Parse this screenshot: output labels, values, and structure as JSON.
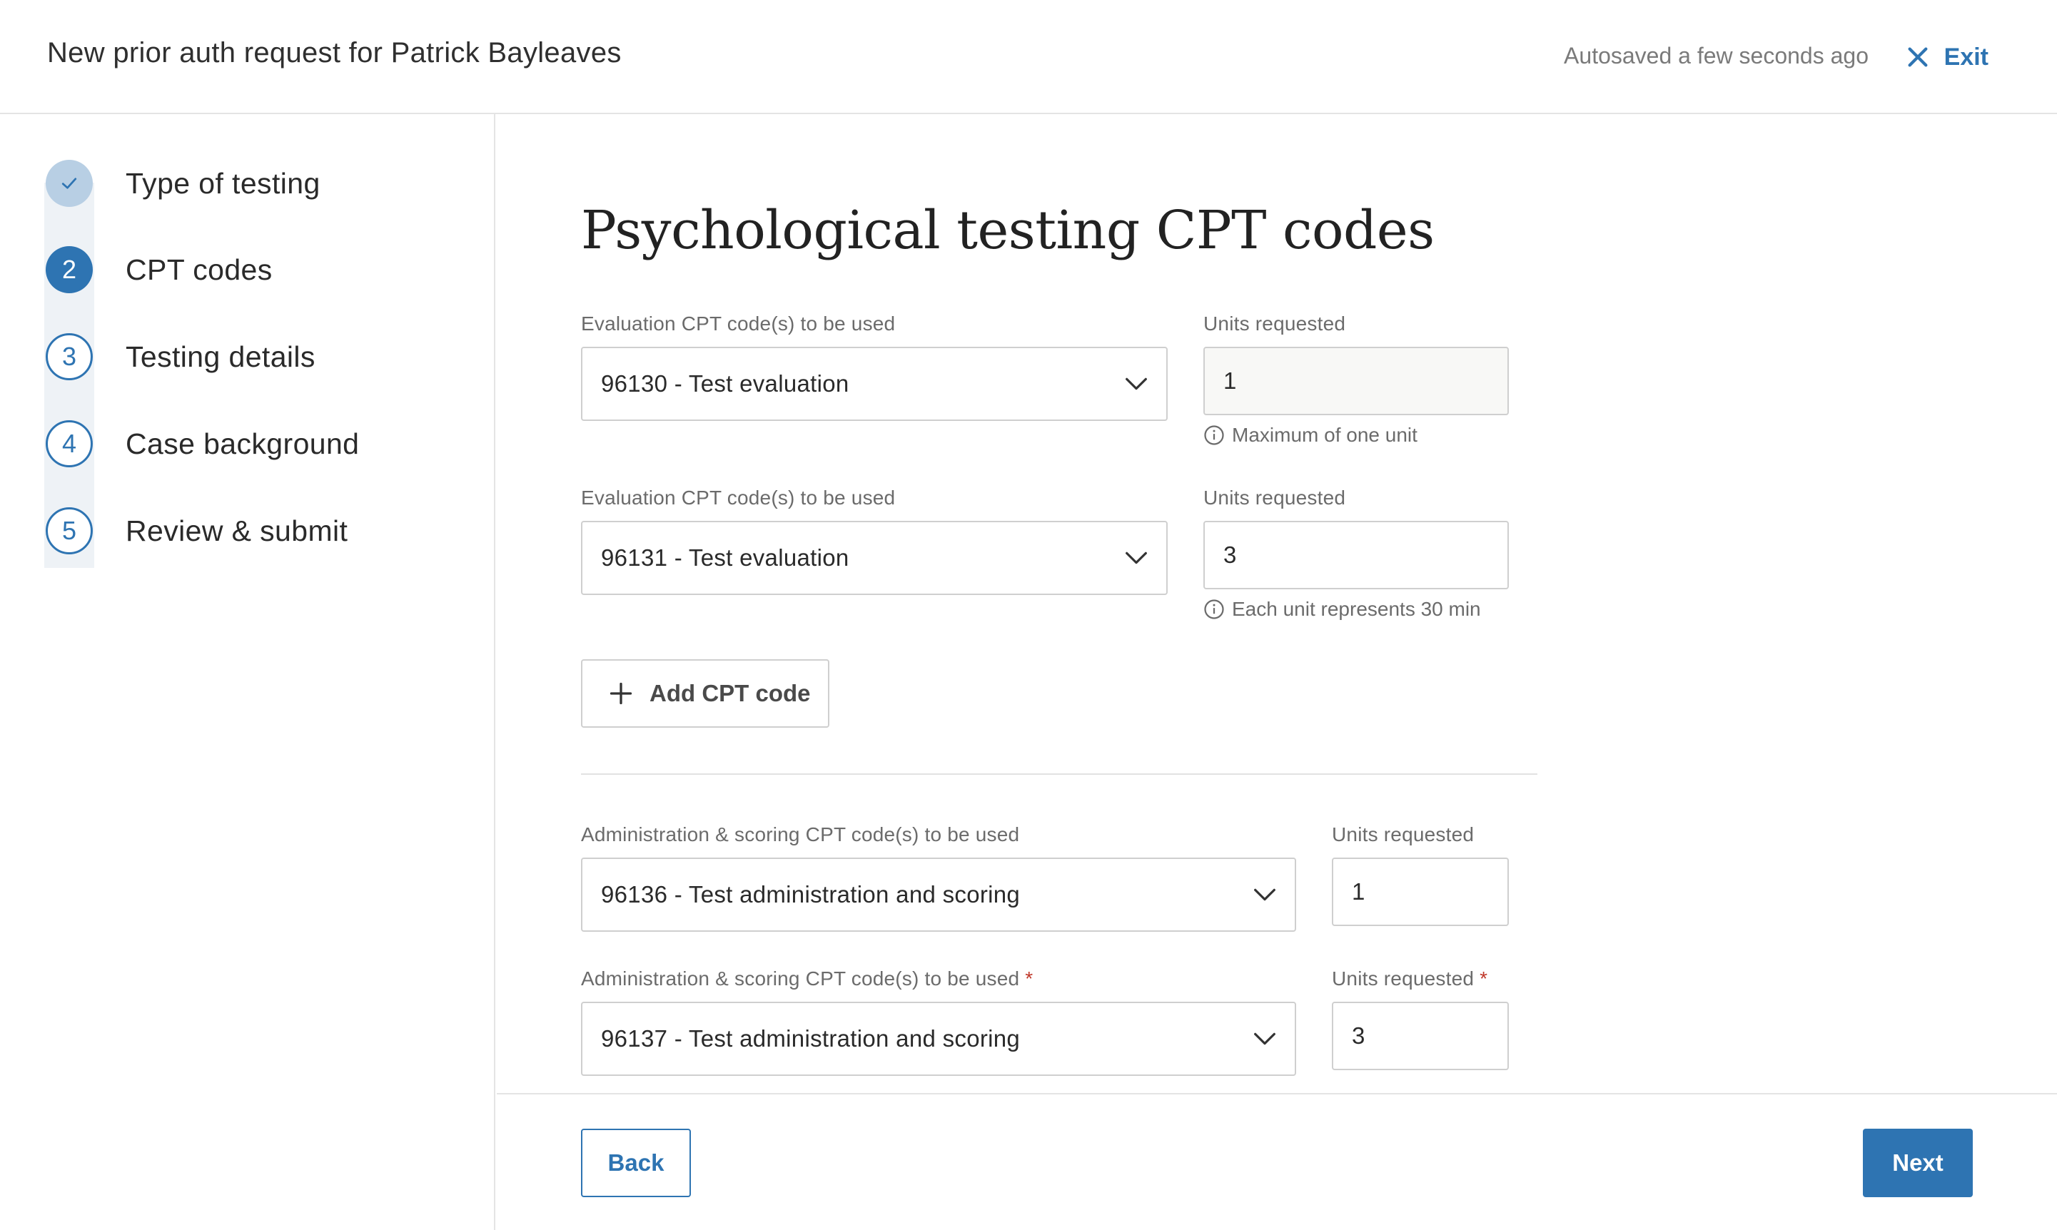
{
  "header": {
    "title": "New prior auth request for Patrick Bayleaves",
    "autosave_status": "Autosaved a few seconds ago",
    "exit_label": "Exit"
  },
  "steps": [
    {
      "number": "",
      "label": "Type of testing",
      "state": "completed",
      "icon": "check-icon"
    },
    {
      "number": "2",
      "label": "CPT codes",
      "state": "current"
    },
    {
      "number": "3",
      "label": "Testing details",
      "state": "upcoming"
    },
    {
      "number": "4",
      "label": "Case background",
      "state": "upcoming"
    },
    {
      "number": "5",
      "label": "Review & submit",
      "state": "upcoming"
    }
  ],
  "main": {
    "heading": "Psychological testing CPT codes",
    "evaluation_rows": [
      {
        "code_label": "Evaluation CPT code(s) to be used",
        "code_value": "96130 - Test evaluation",
        "units_label": "Units requested",
        "units_value": "1",
        "hint": "Maximum of one unit"
      },
      {
        "code_label": "Evaluation CPT code(s) to be used",
        "code_value": "96131 - Test evaluation",
        "units_label": "Units requested",
        "units_value": "3",
        "hint": "Each unit represents 30 min"
      }
    ],
    "add_cpt_label": "Add CPT code",
    "admin_rows": [
      {
        "code_label": "Administration & scoring CPT code(s) to be used",
        "code_value": "96136 - Test administration and scoring",
        "units_label": "Units requested",
        "units_value": "1",
        "required": false
      },
      {
        "code_label": "Administration & scoring CPT code(s) to be used",
        "code_value": "96137 - Test administration and scoring",
        "units_label": "Units requested",
        "units_value": "3",
        "required": true
      }
    ],
    "required_marker": "*"
  },
  "footer": {
    "back_label": "Back",
    "next_label": "Next"
  },
  "colors": {
    "accent": "#2e74b2",
    "completed_step": "#b8cfe4",
    "rail": "#eef2f6",
    "required": "#c0392b"
  }
}
